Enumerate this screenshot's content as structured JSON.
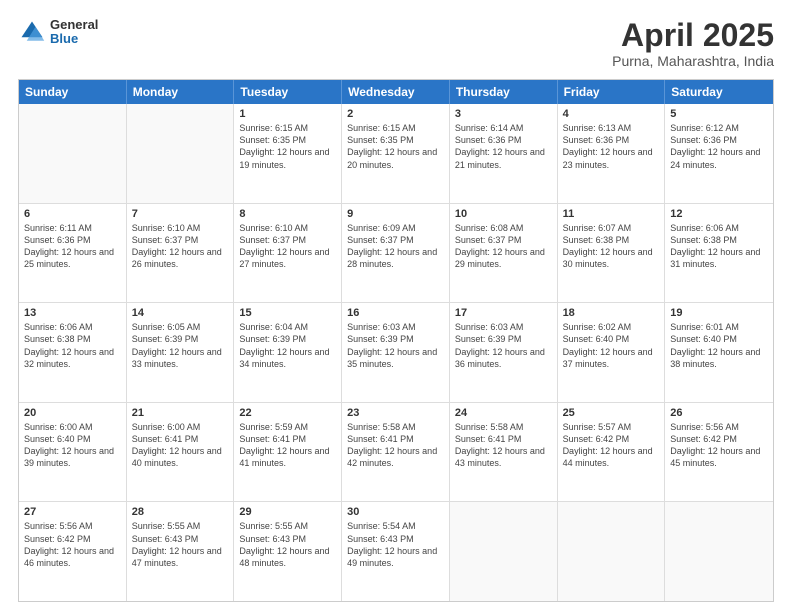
{
  "header": {
    "logo_general": "General",
    "logo_blue": "Blue",
    "title": "April 2025",
    "subtitle": "Purna, Maharashtra, India"
  },
  "calendar": {
    "days": [
      "Sunday",
      "Monday",
      "Tuesday",
      "Wednesday",
      "Thursday",
      "Friday",
      "Saturday"
    ],
    "weeks": [
      [
        {
          "day": "",
          "empty": true
        },
        {
          "day": "",
          "empty": true
        },
        {
          "day": "1",
          "sunrise": "Sunrise: 6:15 AM",
          "sunset": "Sunset: 6:35 PM",
          "daylight": "Daylight: 12 hours and 19 minutes."
        },
        {
          "day": "2",
          "sunrise": "Sunrise: 6:15 AM",
          "sunset": "Sunset: 6:35 PM",
          "daylight": "Daylight: 12 hours and 20 minutes."
        },
        {
          "day": "3",
          "sunrise": "Sunrise: 6:14 AM",
          "sunset": "Sunset: 6:36 PM",
          "daylight": "Daylight: 12 hours and 21 minutes."
        },
        {
          "day": "4",
          "sunrise": "Sunrise: 6:13 AM",
          "sunset": "Sunset: 6:36 PM",
          "daylight": "Daylight: 12 hours and 23 minutes."
        },
        {
          "day": "5",
          "sunrise": "Sunrise: 6:12 AM",
          "sunset": "Sunset: 6:36 PM",
          "daylight": "Daylight: 12 hours and 24 minutes."
        }
      ],
      [
        {
          "day": "6",
          "sunrise": "Sunrise: 6:11 AM",
          "sunset": "Sunset: 6:36 PM",
          "daylight": "Daylight: 12 hours and 25 minutes."
        },
        {
          "day": "7",
          "sunrise": "Sunrise: 6:10 AM",
          "sunset": "Sunset: 6:37 PM",
          "daylight": "Daylight: 12 hours and 26 minutes."
        },
        {
          "day": "8",
          "sunrise": "Sunrise: 6:10 AM",
          "sunset": "Sunset: 6:37 PM",
          "daylight": "Daylight: 12 hours and 27 minutes."
        },
        {
          "day": "9",
          "sunrise": "Sunrise: 6:09 AM",
          "sunset": "Sunset: 6:37 PM",
          "daylight": "Daylight: 12 hours and 28 minutes."
        },
        {
          "day": "10",
          "sunrise": "Sunrise: 6:08 AM",
          "sunset": "Sunset: 6:37 PM",
          "daylight": "Daylight: 12 hours and 29 minutes."
        },
        {
          "day": "11",
          "sunrise": "Sunrise: 6:07 AM",
          "sunset": "Sunset: 6:38 PM",
          "daylight": "Daylight: 12 hours and 30 minutes."
        },
        {
          "day": "12",
          "sunrise": "Sunrise: 6:06 AM",
          "sunset": "Sunset: 6:38 PM",
          "daylight": "Daylight: 12 hours and 31 minutes."
        }
      ],
      [
        {
          "day": "13",
          "sunrise": "Sunrise: 6:06 AM",
          "sunset": "Sunset: 6:38 PM",
          "daylight": "Daylight: 12 hours and 32 minutes."
        },
        {
          "day": "14",
          "sunrise": "Sunrise: 6:05 AM",
          "sunset": "Sunset: 6:39 PM",
          "daylight": "Daylight: 12 hours and 33 minutes."
        },
        {
          "day": "15",
          "sunrise": "Sunrise: 6:04 AM",
          "sunset": "Sunset: 6:39 PM",
          "daylight": "Daylight: 12 hours and 34 minutes."
        },
        {
          "day": "16",
          "sunrise": "Sunrise: 6:03 AM",
          "sunset": "Sunset: 6:39 PM",
          "daylight": "Daylight: 12 hours and 35 minutes."
        },
        {
          "day": "17",
          "sunrise": "Sunrise: 6:03 AM",
          "sunset": "Sunset: 6:39 PM",
          "daylight": "Daylight: 12 hours and 36 minutes."
        },
        {
          "day": "18",
          "sunrise": "Sunrise: 6:02 AM",
          "sunset": "Sunset: 6:40 PM",
          "daylight": "Daylight: 12 hours and 37 minutes."
        },
        {
          "day": "19",
          "sunrise": "Sunrise: 6:01 AM",
          "sunset": "Sunset: 6:40 PM",
          "daylight": "Daylight: 12 hours and 38 minutes."
        }
      ],
      [
        {
          "day": "20",
          "sunrise": "Sunrise: 6:00 AM",
          "sunset": "Sunset: 6:40 PM",
          "daylight": "Daylight: 12 hours and 39 minutes."
        },
        {
          "day": "21",
          "sunrise": "Sunrise: 6:00 AM",
          "sunset": "Sunset: 6:41 PM",
          "daylight": "Daylight: 12 hours and 40 minutes."
        },
        {
          "day": "22",
          "sunrise": "Sunrise: 5:59 AM",
          "sunset": "Sunset: 6:41 PM",
          "daylight": "Daylight: 12 hours and 41 minutes."
        },
        {
          "day": "23",
          "sunrise": "Sunrise: 5:58 AM",
          "sunset": "Sunset: 6:41 PM",
          "daylight": "Daylight: 12 hours and 42 minutes."
        },
        {
          "day": "24",
          "sunrise": "Sunrise: 5:58 AM",
          "sunset": "Sunset: 6:41 PM",
          "daylight": "Daylight: 12 hours and 43 minutes."
        },
        {
          "day": "25",
          "sunrise": "Sunrise: 5:57 AM",
          "sunset": "Sunset: 6:42 PM",
          "daylight": "Daylight: 12 hours and 44 minutes."
        },
        {
          "day": "26",
          "sunrise": "Sunrise: 5:56 AM",
          "sunset": "Sunset: 6:42 PM",
          "daylight": "Daylight: 12 hours and 45 minutes."
        }
      ],
      [
        {
          "day": "27",
          "sunrise": "Sunrise: 5:56 AM",
          "sunset": "Sunset: 6:42 PM",
          "daylight": "Daylight: 12 hours and 46 minutes."
        },
        {
          "day": "28",
          "sunrise": "Sunrise: 5:55 AM",
          "sunset": "Sunset: 6:43 PM",
          "daylight": "Daylight: 12 hours and 47 minutes."
        },
        {
          "day": "29",
          "sunrise": "Sunrise: 5:55 AM",
          "sunset": "Sunset: 6:43 PM",
          "daylight": "Daylight: 12 hours and 48 minutes."
        },
        {
          "day": "30",
          "sunrise": "Sunrise: 5:54 AM",
          "sunset": "Sunset: 6:43 PM",
          "daylight": "Daylight: 12 hours and 49 minutes."
        },
        {
          "day": "",
          "empty": true
        },
        {
          "day": "",
          "empty": true
        },
        {
          "day": "",
          "empty": true
        }
      ]
    ]
  }
}
